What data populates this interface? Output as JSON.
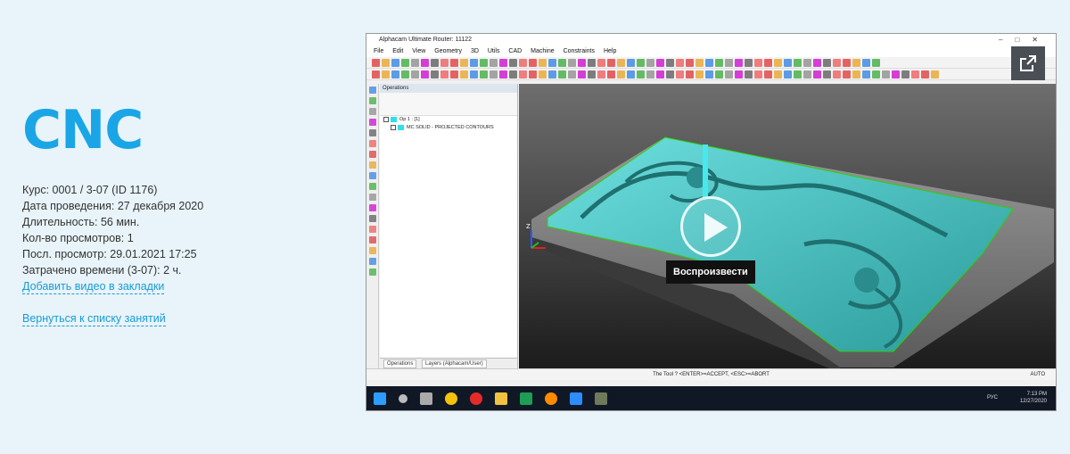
{
  "page": {
    "title": "CNC",
    "meta": [
      "Курс: 0001 / 3-07 (ID 1176)",
      "Дата проведения: 27 декабря 2020",
      "Длительность: 56 мин.",
      "Кол-во просмотров: 1",
      "Посл. просмотр: 29.01.2021 17:25",
      "Затрачено времени (3-07): 2 ч."
    ],
    "add_bookmark": "Добавить видео в закладки",
    "back_link": "Вернуться к списку занятий"
  },
  "video": {
    "play_tooltip": "Воспроизвести",
    "external_icon": "external-link-icon",
    "colors": {
      "accent": "#1aa6e6",
      "external_btn": "#4a4f55",
      "model": "#3fc9c9"
    },
    "app": {
      "window_title": "Alphacam Ultimate Router: 11122",
      "menu": [
        "File",
        "Edit",
        "View",
        "Geometry",
        "3D",
        "Utils",
        "CAD",
        "Machine",
        "Constraints",
        "Help"
      ],
      "operations_title": "Operations",
      "op1": "Op 1 : [1]",
      "op_item": "MC SOLID - PROJECTED CONTOURS",
      "tab_operations": "Operations",
      "tab_layers": "Layers (Alphacam/User)",
      "status_text": "The Tool ? <ENTER>=ACCEPT, <ESC>=ABORT",
      "status_mode": "AUTO",
      "axis_z": "Z",
      "tray_lang": "РУС",
      "tray_time": "7:13 PM",
      "tray_date": "12/27/2020"
    }
  }
}
